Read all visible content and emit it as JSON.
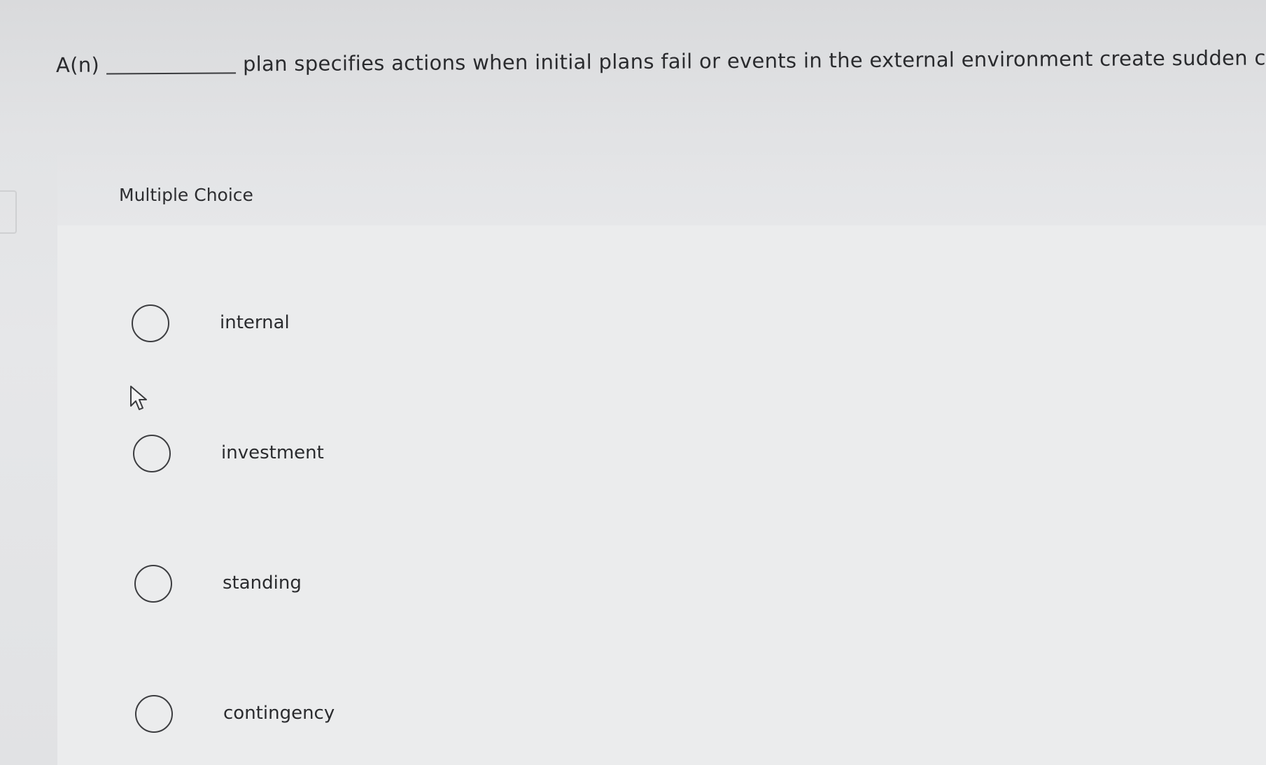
{
  "question": {
    "prefix": "A(n)",
    "stem": "plan specifies actions when initial plans fail or events in the external environment create sudden chan"
  },
  "section": {
    "title": "Multiple Choice"
  },
  "options": [
    {
      "label": "internal",
      "selected": false
    },
    {
      "label": "investment",
      "selected": false
    },
    {
      "label": "standing",
      "selected": false
    },
    {
      "label": "contingency",
      "selected": false
    }
  ],
  "icons": {
    "radio": "radio-unchecked-icon",
    "cursor": "mouse-pointer-icon"
  },
  "colors": {
    "page_background": "#e2e3e5",
    "card_background": "#ebeced",
    "text": "#2a2b2e",
    "radio_border": "#3c3d40"
  }
}
